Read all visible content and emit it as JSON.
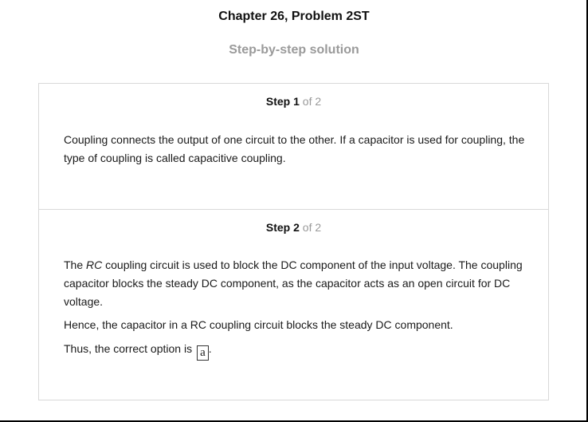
{
  "header": {
    "title": "Chapter 26, Problem 2ST",
    "subtitle": "Step-by-step solution"
  },
  "steps": [
    {
      "label": "Step",
      "number": "1",
      "of_total": "of 2",
      "paragraphs": [
        "Coupling connects the output of one circuit to the other. If a capacitor is used for coupling, the type of coupling is called capacitive coupling."
      ]
    },
    {
      "label": "Step",
      "number": "2",
      "of_total": "of 2",
      "paragraph_1": {
        "before": "The ",
        "italic": "RC",
        "after": " coupling circuit is used to block the DC component of the input voltage. The coupling capacitor blocks the steady DC component, as the capacitor acts as an open circuit for DC voltage."
      },
      "paragraph_2": "Hence, the capacitor in a RC coupling circuit blocks the steady DC component.",
      "answer_prefix": "Thus, the correct option is",
      "answer": "a",
      "answer_suffix": "."
    }
  ]
}
